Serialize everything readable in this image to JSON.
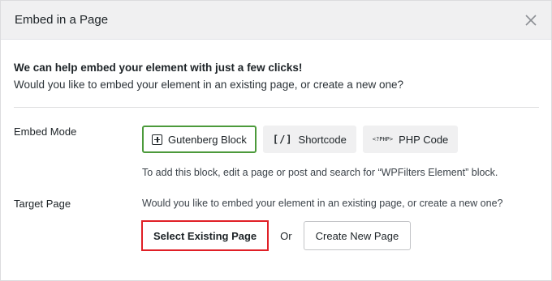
{
  "modal": {
    "title": "Embed in a Page",
    "close_icon": "close-icon"
  },
  "intro": {
    "heading": "We can help embed your element with just a few clicks!",
    "text": "Would you like to embed your element in an existing page, or create a new one?"
  },
  "embed_mode": {
    "label": "Embed Mode",
    "options": [
      {
        "label": "Gutenberg Block",
        "icon": "block-plus-icon",
        "icon_text": "",
        "active": true
      },
      {
        "label": "Shortcode",
        "icon": "shortcode-brackets-icon",
        "icon_text": "[/]",
        "active": false
      },
      {
        "label": "PHP Code",
        "icon": "php-code-icon",
        "icon_text": "<?PHP>",
        "active": false
      }
    ],
    "hint": "To add this block, edit a page or post and search for “WPFilters Element” block."
  },
  "target_page": {
    "label": "Target Page",
    "question": "Would you like to embed your element in an existing page, or create a new one?",
    "select_existing_label": "Select Existing Page",
    "or_label": "Or",
    "create_new_label": "Create New Page"
  },
  "colors": {
    "active_border": "#4c9a3b",
    "highlight_border": "#e01f26",
    "header_bg": "#f0f0f1"
  }
}
